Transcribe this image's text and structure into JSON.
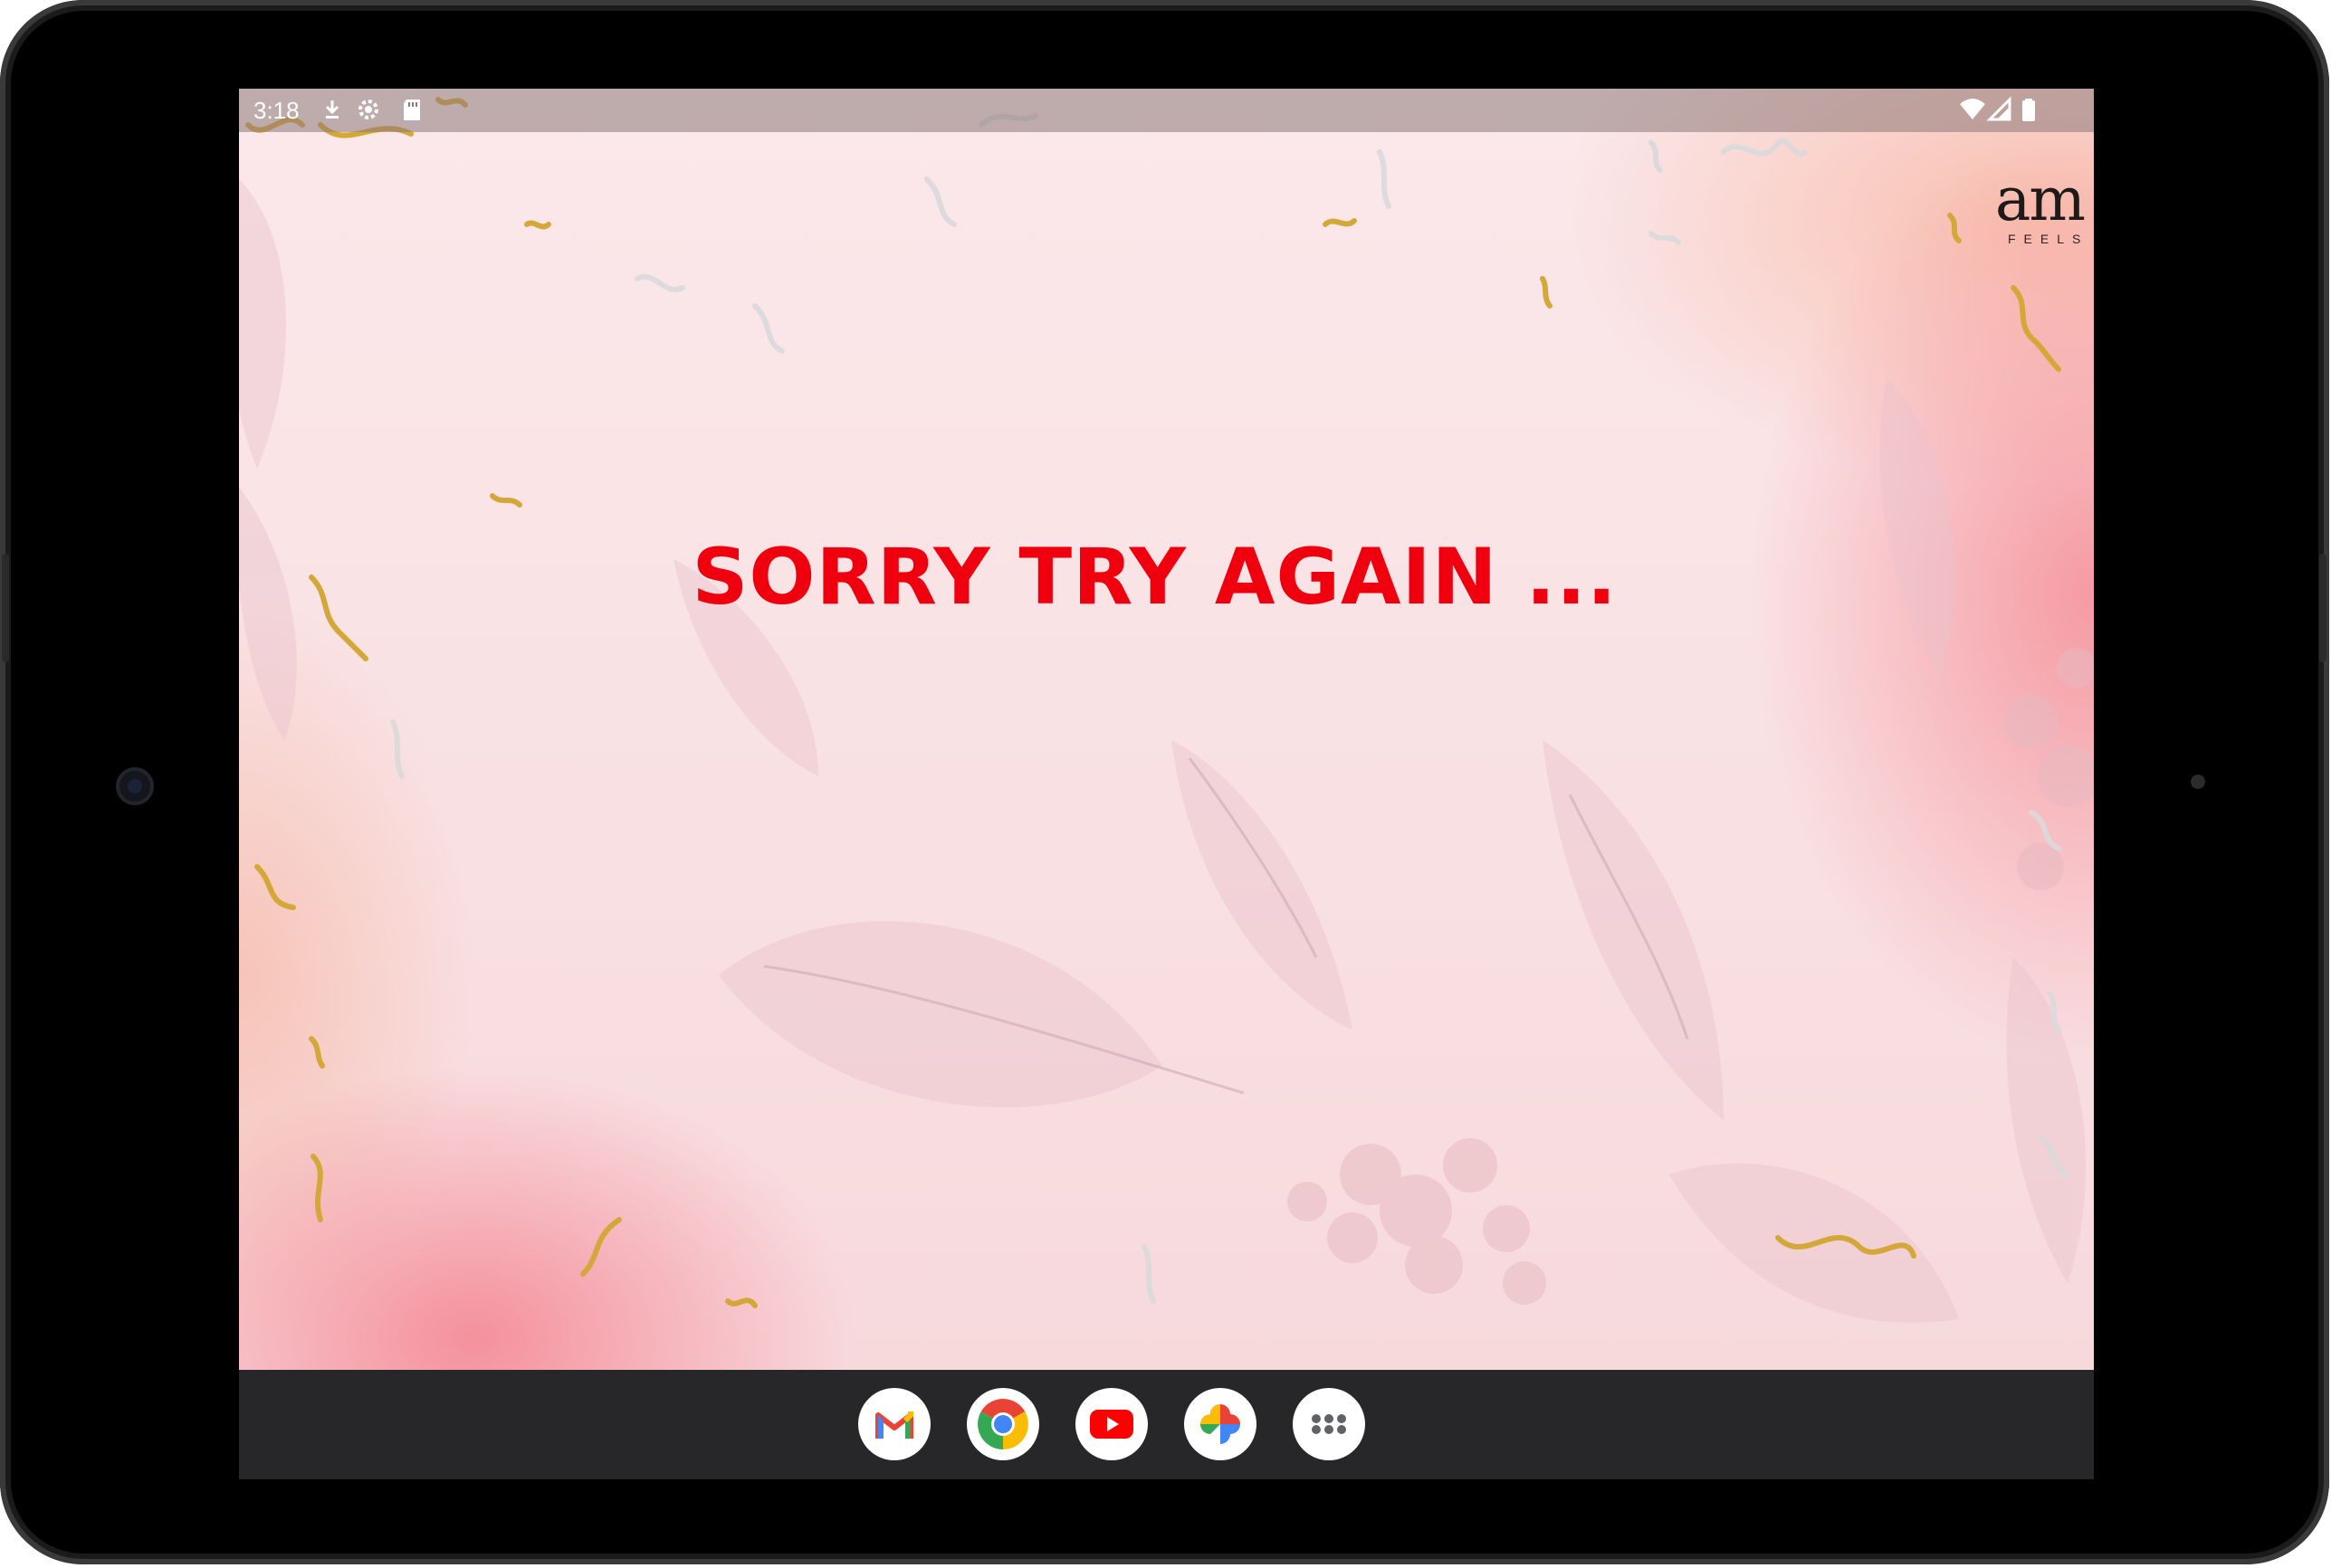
{
  "status_bar": {
    "time": "3:18",
    "left_icons": [
      "download-icon",
      "settings-icon",
      "sd-card-icon"
    ],
    "right_icons": [
      "wifi-icon",
      "signal-icon",
      "battery-icon"
    ]
  },
  "brand": {
    "logo_text": "am",
    "logo_subtext": "FEELS"
  },
  "message": {
    "text": "SORRY TRY AGAIN ...",
    "color": "#f0000f"
  },
  "taskbar": {
    "apps": [
      {
        "name": "Gmail",
        "icon": "gmail-icon"
      },
      {
        "name": "Chrome",
        "icon": "chrome-icon"
      },
      {
        "name": "YouTube",
        "icon": "youtube-icon"
      },
      {
        "name": "Photos",
        "icon": "photos-icon"
      },
      {
        "name": "App drawer",
        "icon": "app-drawer-icon"
      }
    ]
  },
  "colors": {
    "background_pink": "#f9e4e6",
    "taskbar": "#27272a",
    "accent_red": "#f0000f",
    "confetti_gold": "#d4a838"
  }
}
